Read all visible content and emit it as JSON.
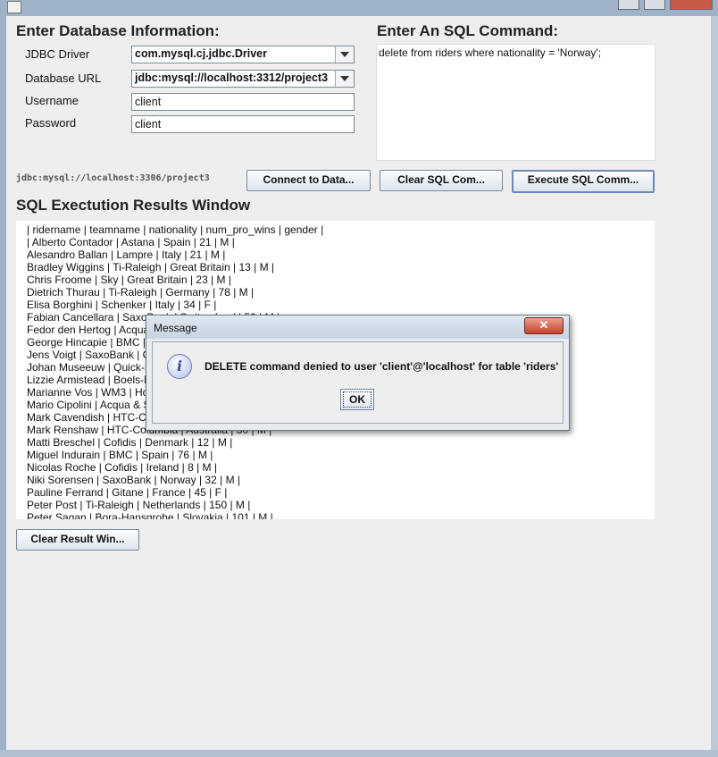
{
  "window": {
    "title": ""
  },
  "db_section": {
    "heading": "Enter Database Information:",
    "driver_label": "JDBC Driver",
    "driver_value": "com.mysql.cj.jdbc.Driver",
    "url_label": "Database URL",
    "url_value": "jdbc:mysql://localhost:3312/project3",
    "username_label": "Username",
    "username_value": "client",
    "password_label": "Password",
    "password_value": "client"
  },
  "sql_section": {
    "heading": "Enter An SQL Command:",
    "command": "delete from riders where nationality = 'Norway';"
  },
  "status": {
    "connection": "jdbc:mysql://localhost:3306/project3"
  },
  "buttons": {
    "connect": "Connect to Data...",
    "clear_sql": "Clear SQL Com...",
    "execute_sql": "Execute SQL Comm...",
    "clear_results": "Clear Result Win..."
  },
  "results": {
    "heading": "SQL Exectution Results Window",
    "lines": [
      "| ridername | teamname | nationality | num_pro_wins | gender |",
      "| Alberto Contador | Astana | Spain | 21 | M |",
      "Alesandro Ballan | Lampre | Italy | 21 | M |",
      "Bradley Wiggins | Ti-Raleigh | Great Britain | 13 | M |",
      "Chris Froome | Sky | Great Britain | 23 | M |",
      "Dietrich Thurau | Ti-Raleigh | Germany | 78 | M |",
      "Elisa Borghini | Schenker | Italy | 34 | F |",
      "Fabian Cancellara | SaxoBank | Switzerland | 50 | M |",
      "Fedor den Hertog | Acqua & Sapone | Netherlands | 30 | M |",
      "George Hincapie | BMC | USA | 19 | M |",
      "Jens Voigt | SaxoBank | Germany | 37 | M |",
      "Johan Museeuw | Quick-Step | Belgium | 53 | M |",
      "Lizzie Armistead | Boels-Dolmans | Great Britain | 12 | F |",
      "Marianne Vos | WM3 | Holland | 48 | F |",
      "Mario Cipolini | Acqua & Sapone | Italy | 150 | M |",
      "Mark Cavendish | HTC-Columbia | Great Britain | 74 | M |",
      "Mark Renshaw | HTC-Columbia | Australia | 30 | M |",
      "Matti Breschel | Cofidis | Denmark | 12 | M |",
      "Miguel Indurain | BMC | Spain | 76 | M |",
      "Nicolas Roche | Cofidis | Ireland | 8 | M |",
      "Niki Sorensen | SaxoBank | Norway | 32 | M |",
      "Pauline Ferrand | Gitane | France | 45 | F |",
      "Peter Post | Ti-Raleigh | Netherlands | 150 | M |",
      "Peter Sagan | Bora-Hansgrohe | Slovakia | 101 | M |"
    ]
  },
  "dialog": {
    "title": "Message",
    "icon": "info-icon",
    "message": "DELETE command denied to user 'client'@'localhost' for table 'riders'",
    "ok_label": "OK"
  }
}
